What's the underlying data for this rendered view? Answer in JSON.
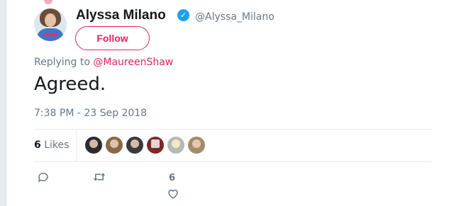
{
  "user": {
    "display_name": "Alyssa Milano",
    "handle": "@Alyssa_Milano",
    "verified": true
  },
  "follow_button": {
    "label": "Follow"
  },
  "reply_context": {
    "prefix": "Replying to ",
    "mention": "@MaureenShaw"
  },
  "tweet": {
    "text": "Agreed.",
    "timestamp": "7:38 PM - 23 Sep 2018"
  },
  "stats": {
    "likes_count": "6",
    "likes_label": " Likes"
  },
  "likers": [
    {
      "name": "liker-1",
      "color": "#2b2b2b"
    },
    {
      "name": "liker-2",
      "color": "#8a6a45"
    },
    {
      "name": "liker-3",
      "color": "#3a3a3a"
    },
    {
      "name": "liker-4",
      "color": "#7a2a2a"
    },
    {
      "name": "liker-5",
      "color": "#b8b8b8"
    },
    {
      "name": "liker-6",
      "color": "#a48b6a"
    }
  ],
  "actions": {
    "reply_icon": "reply-icon",
    "retweet_icon": "retweet-icon",
    "like_icon": "heart-icon",
    "like_count": "6"
  },
  "colors": {
    "accent": "#e0245e",
    "verified": "#1da1f2",
    "muted": "#657786"
  }
}
